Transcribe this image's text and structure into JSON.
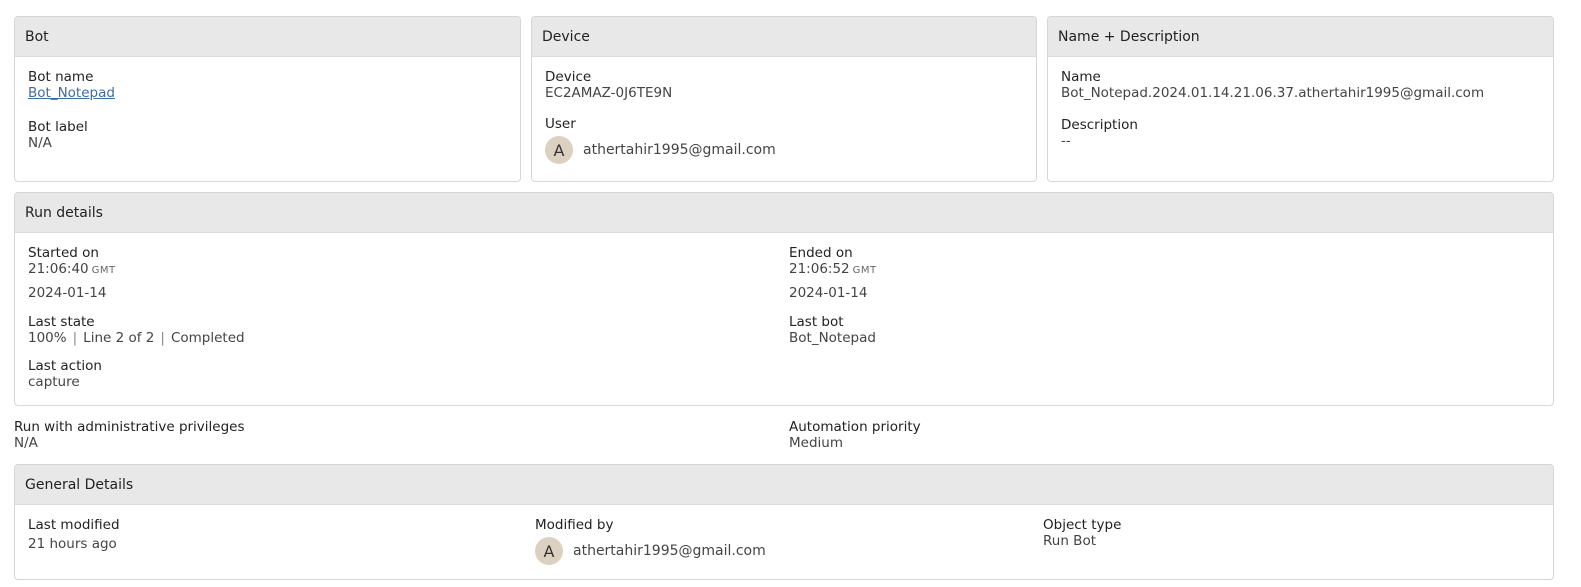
{
  "bot_panel": {
    "title": "Bot",
    "bot_name_label": "Bot name",
    "bot_name_value": "Bot_Notepad",
    "bot_label_label": "Bot label",
    "bot_label_value": "N/A"
  },
  "device_panel": {
    "title": "Device",
    "device_label": "Device",
    "device_value": "EC2AMAZ-0J6TE9N",
    "user_label": "User",
    "user_avatar": "A",
    "user_email": "athertahir1995@gmail.com"
  },
  "name_panel": {
    "title": "Name + Description",
    "name_label": "Name",
    "name_value": "Bot_Notepad.2024.01.14.21.06.37.athertahir1995@gmail.com",
    "description_label": "Description",
    "description_value": "--"
  },
  "run_details": {
    "title": "Run details",
    "started_label": "Started on",
    "started_time": "21:06:40",
    "started_tz": "GMT",
    "started_date": "2024-01-14",
    "ended_label": "Ended on",
    "ended_time": "21:06:52",
    "ended_tz": "GMT",
    "ended_date": "2024-01-14",
    "last_state_label": "Last state",
    "last_state_percent": "100%",
    "last_state_line": "Line 2 of 2",
    "last_state_status": "Completed",
    "separator": "|",
    "last_bot_label": "Last bot",
    "last_bot_value": "Bot_Notepad",
    "last_action_label": "Last action",
    "last_action_value": "capture"
  },
  "privileges": {
    "admin_label": "Run with administrative privileges",
    "admin_value": "N/A",
    "priority_label": "Automation priority",
    "priority_value": "Medium"
  },
  "general_details": {
    "title": "General Details",
    "last_modified_label": "Last modified",
    "last_modified_value": "21 hours ago",
    "modified_by_label": "Modified by",
    "modified_by_avatar": "A",
    "modified_by_email": "athertahir1995@gmail.com",
    "object_type_label": "Object type",
    "object_type_value": "Run Bot"
  }
}
